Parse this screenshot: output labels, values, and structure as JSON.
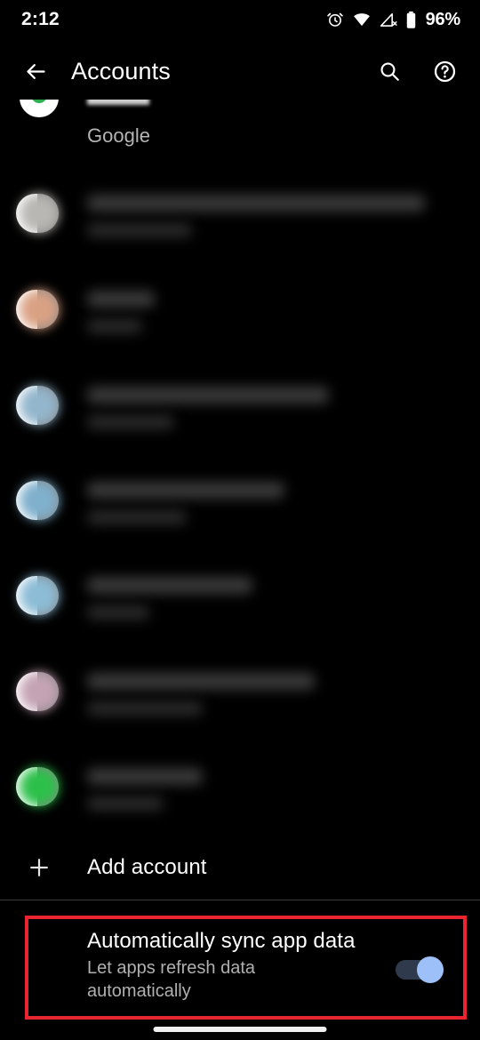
{
  "status_bar": {
    "time": "2:12",
    "battery_percent": "96%",
    "icons": [
      "alarm-icon",
      "wifi-icon",
      "cellular-no-service-icon",
      "battery-icon"
    ]
  },
  "app_bar": {
    "title": "Accounts",
    "back_icon": "back-arrow-icon",
    "actions": [
      {
        "name": "search-icon",
        "label": "Search"
      },
      {
        "name": "help-icon",
        "label": "Help"
      }
    ]
  },
  "accounts": {
    "partial_top_item": {
      "label": "Google",
      "avatar_color": "#ffffff",
      "accent_color": "#2bb14f"
    },
    "items": [
      {
        "avatar_color": "#b9b7b3",
        "title_width": 380,
        "sub_width": 118,
        "redacted": true
      },
      {
        "avatar_color": "#d9a184",
        "title_width": 76,
        "sub_width": 62,
        "redacted": true
      },
      {
        "avatar_color": "#93b6cc",
        "title_width": 272,
        "sub_width": 98,
        "redacted": true
      },
      {
        "avatar_color": "#7fb0cc",
        "title_width": 222,
        "sub_width": 112,
        "redacted": true
      },
      {
        "avatar_color": "#8cbcd6",
        "title_width": 186,
        "sub_width": 70,
        "redacted": true
      },
      {
        "avatar_color": "#c4a3b4",
        "title_width": 256,
        "sub_width": 130,
        "redacted": true
      },
      {
        "avatar_color": "#2cc04a",
        "title_width": 130,
        "sub_width": 86,
        "redacted": true
      }
    ]
  },
  "add_account": {
    "label": "Add account",
    "icon": "plus-icon"
  },
  "sync_setting": {
    "title": "Automatically sync app data",
    "subtitle": "Let apps refresh data\nautomatically",
    "toggle_state": "on",
    "toggle_thumb_color": "#9cc0f7",
    "toggle_track_color": "#2f3b4d",
    "highlight_color": "#ea2430"
  },
  "gesture_bar": {
    "label": "home-gesture-bar"
  }
}
